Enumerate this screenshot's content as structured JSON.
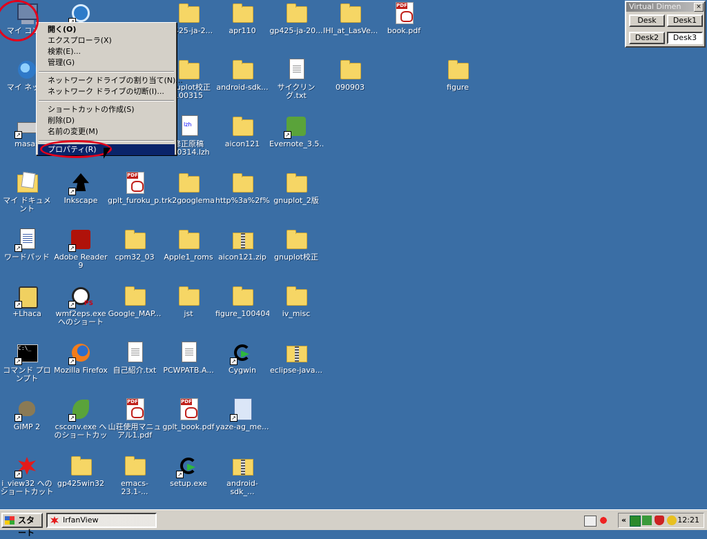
{
  "desktop": {
    "icons": [
      {
        "label": "マイ コンピ",
        "type": "pc"
      },
      {
        "label": "",
        "type": "ie"
      },
      {
        "label": "gp425-ja-2...",
        "type": "folder"
      },
      {
        "label": "apr110",
        "type": "folder"
      },
      {
        "label": "gp425-ja-20...",
        "type": "folder"
      },
      {
        "label": "IHI_at_LasVe...",
        "type": "folder"
      },
      {
        "label": "book.pdf",
        "type": "pdf"
      },
      {
        "label": "マイ ネット",
        "type": "net"
      },
      {
        "label": "gnuplot校正 100315",
        "type": "folder"
      },
      {
        "label": "android-sdk...",
        "type": "folder"
      },
      {
        "label": "サイクリング.txt",
        "type": "doc"
      },
      {
        "label": "090903",
        "type": "folder"
      },
      {
        "label": "figure",
        "type": "folder"
      },
      {
        "label": "masas",
        "type": "drive"
      },
      {
        "label": "修正原稿 100314.lzh",
        "type": "lzh"
      },
      {
        "label": "aicon121",
        "type": "folder"
      },
      {
        "label": "Evernote_3.5...",
        "type": "ever"
      },
      {
        "label": "マイ ドキュメント",
        "type": "mydoc"
      },
      {
        "label": "Inkscape",
        "type": "ink"
      },
      {
        "label": "gplt_furoku_p...",
        "type": "pdf"
      },
      {
        "label": "trk2googlema...",
        "type": "folder"
      },
      {
        "label": "http%3a%2f%2...",
        "type": "folder"
      },
      {
        "label": "gnuplot_2版",
        "type": "folder"
      },
      {
        "label": "ワードパッド",
        "type": "wordpad"
      },
      {
        "label": "Adobe Reader 9",
        "type": "red"
      },
      {
        "label": "cpm32_03",
        "type": "folder"
      },
      {
        "label": "Apple1_roms",
        "type": "folder"
      },
      {
        "label": "aicon121.zip",
        "type": "zip"
      },
      {
        "label": "gnuplot校正",
        "type": "folder"
      },
      {
        "label": "+Lhaca",
        "type": "lhaca"
      },
      {
        "label": "wmf2eps.exe へのショートカ...",
        "type": "wmf"
      },
      {
        "label": "Google_MAP...",
        "type": "folder"
      },
      {
        "label": "jst",
        "type": "folder"
      },
      {
        "label": "figure_100404",
        "type": "folder"
      },
      {
        "label": "iv_misc",
        "type": "folder"
      },
      {
        "label": "コマンド プロンプト",
        "type": "cmd"
      },
      {
        "label": "Mozilla Firefox",
        "type": "fox"
      },
      {
        "label": "自己紹介.txt",
        "type": "doc"
      },
      {
        "label": "PCWPATB.A...",
        "type": "doc"
      },
      {
        "label": "Cygwin",
        "type": "cyg"
      },
      {
        "label": "eclipse-java...",
        "type": "zip"
      },
      {
        "label": "GIMP 2",
        "type": "gimp"
      },
      {
        "label": "csconv.exe へのショートカット",
        "type": "leaf"
      },
      {
        "label": "山荘使用マニュアル1.pdf",
        "type": "pdf"
      },
      {
        "label": "gplt_book.pdf",
        "type": "pdf"
      },
      {
        "label": "yaze-ag_me...",
        "type": "yaze"
      },
      {
        "label": "i_view32 へのショートカット",
        "type": "iview"
      },
      {
        "label": "gp425win32",
        "type": "folder"
      },
      {
        "label": "emacs-23.1-...",
        "type": "folder"
      },
      {
        "label": "setup.exe",
        "type": "cyg"
      },
      {
        "label": "android-sdk_...",
        "type": "zip"
      }
    ]
  },
  "context_menu": {
    "items": [
      {
        "label": "開く(O)",
        "bold": true
      },
      {
        "label": "エクスプローラ(X)"
      },
      {
        "label": "検索(E)..."
      },
      {
        "label": "管理(G)"
      },
      {
        "sep": true
      },
      {
        "label": "ネットワーク ドライブの割り当て(N)..."
      },
      {
        "label": "ネットワーク ドライブの切断(I)..."
      },
      {
        "sep": true
      },
      {
        "label": "ショートカットの作成(S)"
      },
      {
        "label": "削除(D)"
      },
      {
        "label": "名前の変更(M)"
      },
      {
        "sep": true
      },
      {
        "label": "プロパティ(R)",
        "selected": true
      }
    ]
  },
  "virtual_dimension": {
    "title": "Virtual Dimen",
    "close": "×",
    "desks": [
      "Desk",
      "Desk1",
      "Desk2",
      "Desk3"
    ]
  },
  "taskbar": {
    "start_label": "スタート",
    "task_label": "IrfanView",
    "tray_chevron": "«",
    "clock": "12:21"
  },
  "colors": {
    "desktop": "#3a6ea5",
    "highlight": "#0a246a",
    "annotation": "#e3001b"
  }
}
